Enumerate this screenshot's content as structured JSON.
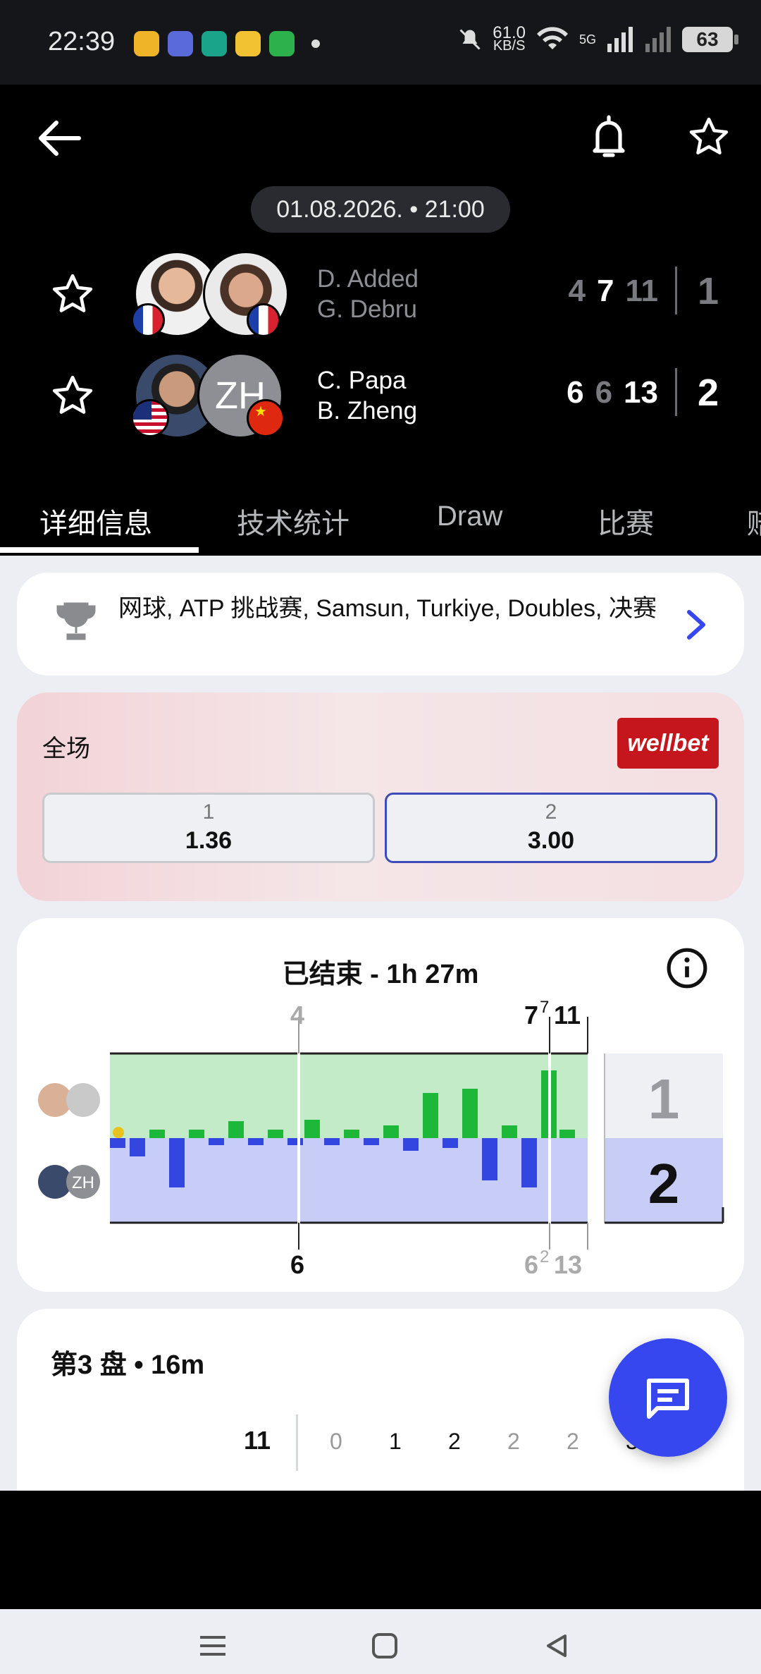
{
  "status_bar": {
    "time": "22:39",
    "net_speed_value": "61.0",
    "net_speed_unit": "KB/S",
    "network_label": "5G",
    "battery": "63",
    "app_icons": [
      "weibo-icon",
      "tieba-icon",
      "link-icon",
      "video-icon",
      "shield-icon"
    ]
  },
  "header": {
    "date_time": "01.08.2026. • 21:00",
    "team1": {
      "player1": "D. Added",
      "player2": "G. Debru",
      "set_scores": [
        "4",
        "7",
        "11"
      ],
      "sets_won": "1",
      "flag1": "france",
      "flag2": "france"
    },
    "team2": {
      "player1": "C. Papa",
      "player2": "B. Zheng",
      "avatar2_initials": "ZH",
      "set_scores": [
        "6",
        "6",
        "13"
      ],
      "sets_won": "2",
      "flag1": "usa",
      "flag2": "china"
    }
  },
  "tabs": [
    {
      "label": "详细信息",
      "active": true
    },
    {
      "label": "技术统计",
      "active": false
    },
    {
      "label": "Draw",
      "active": false
    },
    {
      "label": "比赛",
      "active": false
    },
    {
      "label": "赔",
      "active": false
    }
  ],
  "breadcrumb": {
    "text": "网球, ATP 挑战赛, Samsun, Turkiye, Doubles, 决赛"
  },
  "odds": {
    "title": "全场",
    "provider": "wellbet",
    "options": [
      {
        "label": "1",
        "value": "1.36",
        "selected": false
      },
      {
        "label": "2",
        "value": "3.00",
        "selected": true
      }
    ]
  },
  "momentum": {
    "title": "已结束 - 1h 27m",
    "top_labels": {
      "set1": "4",
      "set2": "7",
      "set2_tb": "7",
      "set3": "11"
    },
    "bottom_labels": {
      "set1": "6",
      "set2": "6",
      "set2_tb": "2",
      "set3": "13"
    },
    "sets_won": {
      "team1": "1",
      "team2": "2"
    }
  },
  "set3": {
    "title": "第3 盘 • 16m",
    "team1_total": "11",
    "game_scores": [
      "0",
      "1",
      "2",
      "2",
      "2",
      "3"
    ]
  },
  "colors": {
    "accent_blue": "#3747f0",
    "team1_green": "#1db83a",
    "team2_blue": "#3346e0",
    "odds_brand": "#c4161c"
  }
}
